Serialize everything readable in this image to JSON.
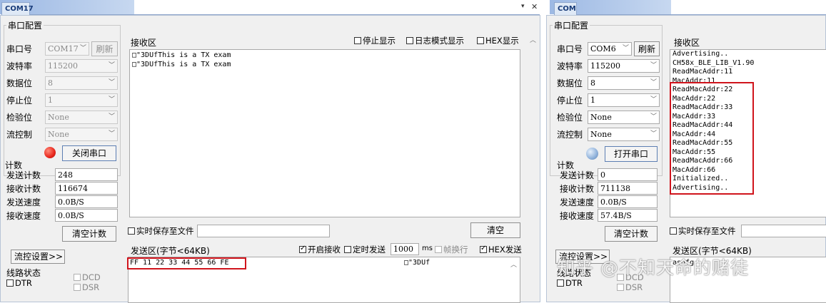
{
  "left": {
    "tab_label": "COM17",
    "tab_menu_icon": "▾",
    "tab_close_icon": "✕",
    "config": {
      "group_label": "串口配置",
      "port_label": "串口号",
      "port_value": "COM17",
      "refresh_label": "刷新",
      "baud_label": "波特率",
      "baud_value": "115200",
      "databits_label": "数据位",
      "databits_value": "8",
      "stopbits_label": "停止位",
      "stopbits_value": "1",
      "parity_label": "检验位",
      "parity_value": "None",
      "flow_label": "流控制",
      "flow_value": "None",
      "toggle_label": "关闭串口",
      "led_color": "#e8261c"
    },
    "counters": {
      "group_label": "计数",
      "tx_count_label": "发送计数",
      "tx_count_value": "248",
      "rx_count_label": "接收计数",
      "rx_count_value": "116674",
      "tx_speed_label": "发送速度",
      "tx_speed_value": "0.0B/S",
      "rx_speed_label": "接收速度",
      "rx_speed_value": "0.0B/S",
      "clear_label": "清空计数"
    },
    "flow_settings_label": "流控设置>>",
    "line_status_label": "线路状态",
    "dtr_label": "DTR",
    "dcd_label": "DCD",
    "dsr_label": "DSR",
    "receive": {
      "title": "接收区",
      "stop_display_label": "停止显示",
      "log_mode_label": "日志模式显示",
      "hex_display_label": "HEX显示",
      "lines": [
        "□\"3DUfThis is a TX exam",
        "□\"3DUfThis is a TX exam"
      ],
      "save_file_label": "实时保存至文件",
      "clear_label": "清空"
    },
    "send": {
      "title": "发送区(字节<64KB)",
      "enable_receive_label": "开启接收",
      "timed_send_label": "定时发送",
      "interval_value": "1000",
      "ms_label": "ms",
      "newline_label": "帧换行",
      "hex_send_label": "HEX发送",
      "content": "FF 11 22 33 44 55 66 FE",
      "echo_text": "□\"3DUf"
    }
  },
  "right": {
    "tab_label": "COM",
    "config": {
      "group_label": "串口配置",
      "port_label": "串口号",
      "port_value": "COM6",
      "refresh_label": "刷新",
      "baud_label": "波特率",
      "baud_value": "115200",
      "databits_label": "数据位",
      "databits_value": "8",
      "stopbits_label": "停止位",
      "stopbits_value": "1",
      "parity_label": "检验位",
      "parity_value": "None",
      "flow_label": "流控制",
      "flow_value": "None",
      "toggle_label": "打开串口",
      "led_color": "#8fb1da"
    },
    "counters": {
      "group_label": "计数",
      "tx_count_label": "发送计数",
      "tx_count_value": "0",
      "rx_count_label": "接收计数",
      "rx_count_value": "711138",
      "tx_speed_label": "发送速度",
      "tx_speed_value": "0.0B/S",
      "rx_speed_label": "接收速度",
      "rx_speed_value": "57.4B/S",
      "clear_label": "清空计数"
    },
    "flow_settings_label": "流控设置>>",
    "line_status_label": "线路状态",
    "dtr_label": "DTR",
    "dcd_label": "DCD",
    "dsr_label": "DSR",
    "receive": {
      "title": "接收区",
      "lines": [
        "Advertising..",
        "CH58x_BLE_LIB_V1.90",
        "ReadMacAddr:11",
        "MacAddr:11",
        "ReadMacAddr:22",
        "MacAddr:22",
        "ReadMacAddr:33",
        "MacAddr:33",
        "ReadMacAddr:44",
        "MacAddr:44",
        "ReadMacAddr:55",
        "MacAddr:55",
        "ReadMacAddr:66",
        "MacAddr:66",
        "Initialized..",
        "Advertising.."
      ],
      "save_file_label": "实时保存至文件"
    },
    "send": {
      "title": "发送区(字节<64KB)",
      "content": "asdfg"
    }
  },
  "watermark": "知乎 @不知天命的赌徒",
  "colors": {
    "highlight_red": "#d0141c",
    "tab_blue": "#173a78"
  }
}
